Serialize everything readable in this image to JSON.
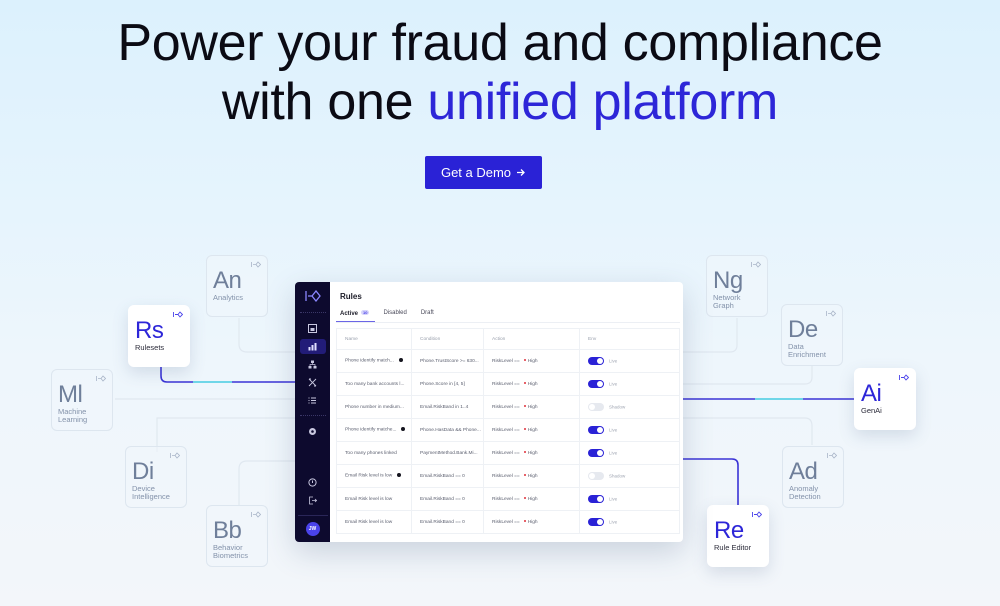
{
  "hero": {
    "title_line1": "Power your fraud and compliance",
    "title_line2_prefix": "with one ",
    "title_line2_accent": "unified platform",
    "cta_label": "Get a Demo",
    "cta_icon": "arrow-right-icon"
  },
  "colors": {
    "accent": "#2d26d8",
    "button": "#2a22d6",
    "sidebar": "#0d0a2e",
    "connector": "#3a33d6",
    "connector_highlight": "#6fd6e8"
  },
  "tiles": [
    {
      "id": "analytics",
      "symbol": "An",
      "label": "Analytics",
      "active": false
    },
    {
      "id": "rulesets",
      "symbol": "Rs",
      "label": "Rulesets",
      "active": true
    },
    {
      "id": "machine-learning",
      "symbol": "Ml",
      "label": "Machine Learning",
      "active": false
    },
    {
      "id": "device-intelligence",
      "symbol": "Di",
      "label": "Device Intelligence",
      "active": false
    },
    {
      "id": "behavior-biometrics",
      "symbol": "Bb",
      "label": "Behavior Biometrics",
      "active": false
    },
    {
      "id": "network-graph",
      "symbol": "Ng",
      "label": "Network Graph",
      "active": false
    },
    {
      "id": "data-enrichment",
      "symbol": "De",
      "label": "Data Enrichment",
      "active": false
    },
    {
      "id": "genai",
      "symbol": "Ai",
      "label": "GenAi",
      "active": true
    },
    {
      "id": "anomaly-detection",
      "symbol": "Ad",
      "label": "Anomaly Detection",
      "active": false
    },
    {
      "id": "rule-editor",
      "symbol": "Re",
      "label": "Rule Editor",
      "active": true
    }
  ],
  "app": {
    "title": "Rules",
    "tabs": [
      {
        "label": "Active",
        "badge": "10",
        "active": true
      },
      {
        "label": "Disabled",
        "active": false
      },
      {
        "label": "Draft",
        "active": false
      }
    ],
    "sidebar": {
      "items": [
        "dashboard-icon",
        "analytics-icon",
        "network-icon",
        "tools-icon",
        "lists-icon",
        "settings-icon"
      ],
      "active_index": 1,
      "bottom": [
        "help-icon",
        "logout-icon"
      ],
      "avatar": "JW"
    },
    "columns": [
      "Name",
      "Condition",
      "Action",
      "Env"
    ],
    "rows": [
      {
        "name": "Phone identify match...",
        "flag": true,
        "condition": "Phone.TrustScore >= 630...",
        "action": "RiskLevel ==",
        "level": "High",
        "env": "Live",
        "on": true
      },
      {
        "name": "Too many bank accounts l...",
        "flag": false,
        "condition": "Phone.Score in [4, 5]",
        "action": "RiskLevel ==",
        "level": "High",
        "env": "Live",
        "on": true
      },
      {
        "name": "Phone number in medium...",
        "flag": false,
        "condition": "Email.RiskBand in 1..4",
        "action": "RiskLevel ==",
        "level": "High",
        "env": "Shadow",
        "on": false
      },
      {
        "name": "Phone identify matche...",
        "flag": true,
        "condition": "Phone.HasData && Phone...",
        "action": "RiskLevel ==",
        "level": "High",
        "env": "Live",
        "on": true
      },
      {
        "name": "Too many phones linked",
        "flag": false,
        "condition": "PaymentMethod.Bank.Mi...",
        "action": "RiskLevel ==",
        "level": "High",
        "env": "Live",
        "on": true
      },
      {
        "name": "Email Risk level is low",
        "flag": true,
        "condition": "Email.RiskBand == 0",
        "action": "RiskLevel ==",
        "level": "High",
        "env": "Shadow",
        "on": false
      },
      {
        "name": "Email Risk level is low",
        "flag": false,
        "condition": "Email.RiskBand == 0",
        "action": "RiskLevel ==",
        "level": "High",
        "env": "Live",
        "on": true
      },
      {
        "name": "Email Risk level is low",
        "flag": false,
        "condition": "Email.RiskBand == 0",
        "action": "RiskLevel ==",
        "level": "High",
        "env": "Live",
        "on": true
      }
    ]
  }
}
